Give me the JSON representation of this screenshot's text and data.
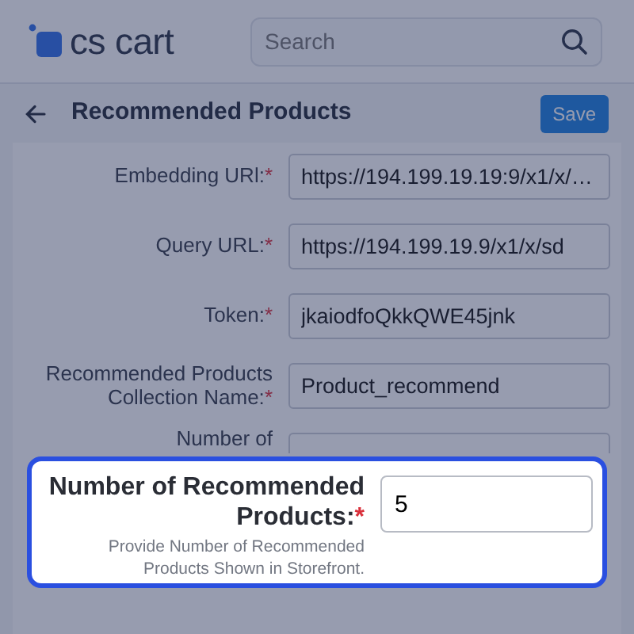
{
  "header": {
    "logo_text": "cs cart",
    "search": {
      "placeholder": "Search"
    }
  },
  "page": {
    "title": "Recommended Products",
    "save_button": "Save"
  },
  "fields": [
    {
      "label": "Embedding URl:",
      "required_mark": "*",
      "value": "https://194.199.19.19:9/x1/x/…"
    },
    {
      "label": "Query URL:",
      "required_mark": "*",
      "value": "https://194.199.19.9/x1/x/sd"
    },
    {
      "label": "Token:",
      "required_mark": "*",
      "value": "jkaiodfoQkkQWE45jnk"
    },
    {
      "label": "Recommended Products Collection Name:",
      "required_mark": "*",
      "value": "Product_recommend"
    },
    {
      "label": "Number of",
      "kind": "cut_off"
    }
  ],
  "callout": {
    "label": "Number of Recommended Products:",
    "required_mark": "*",
    "value": "5",
    "help": "Provide Number of Recommended Products Shown in Storefront."
  }
}
